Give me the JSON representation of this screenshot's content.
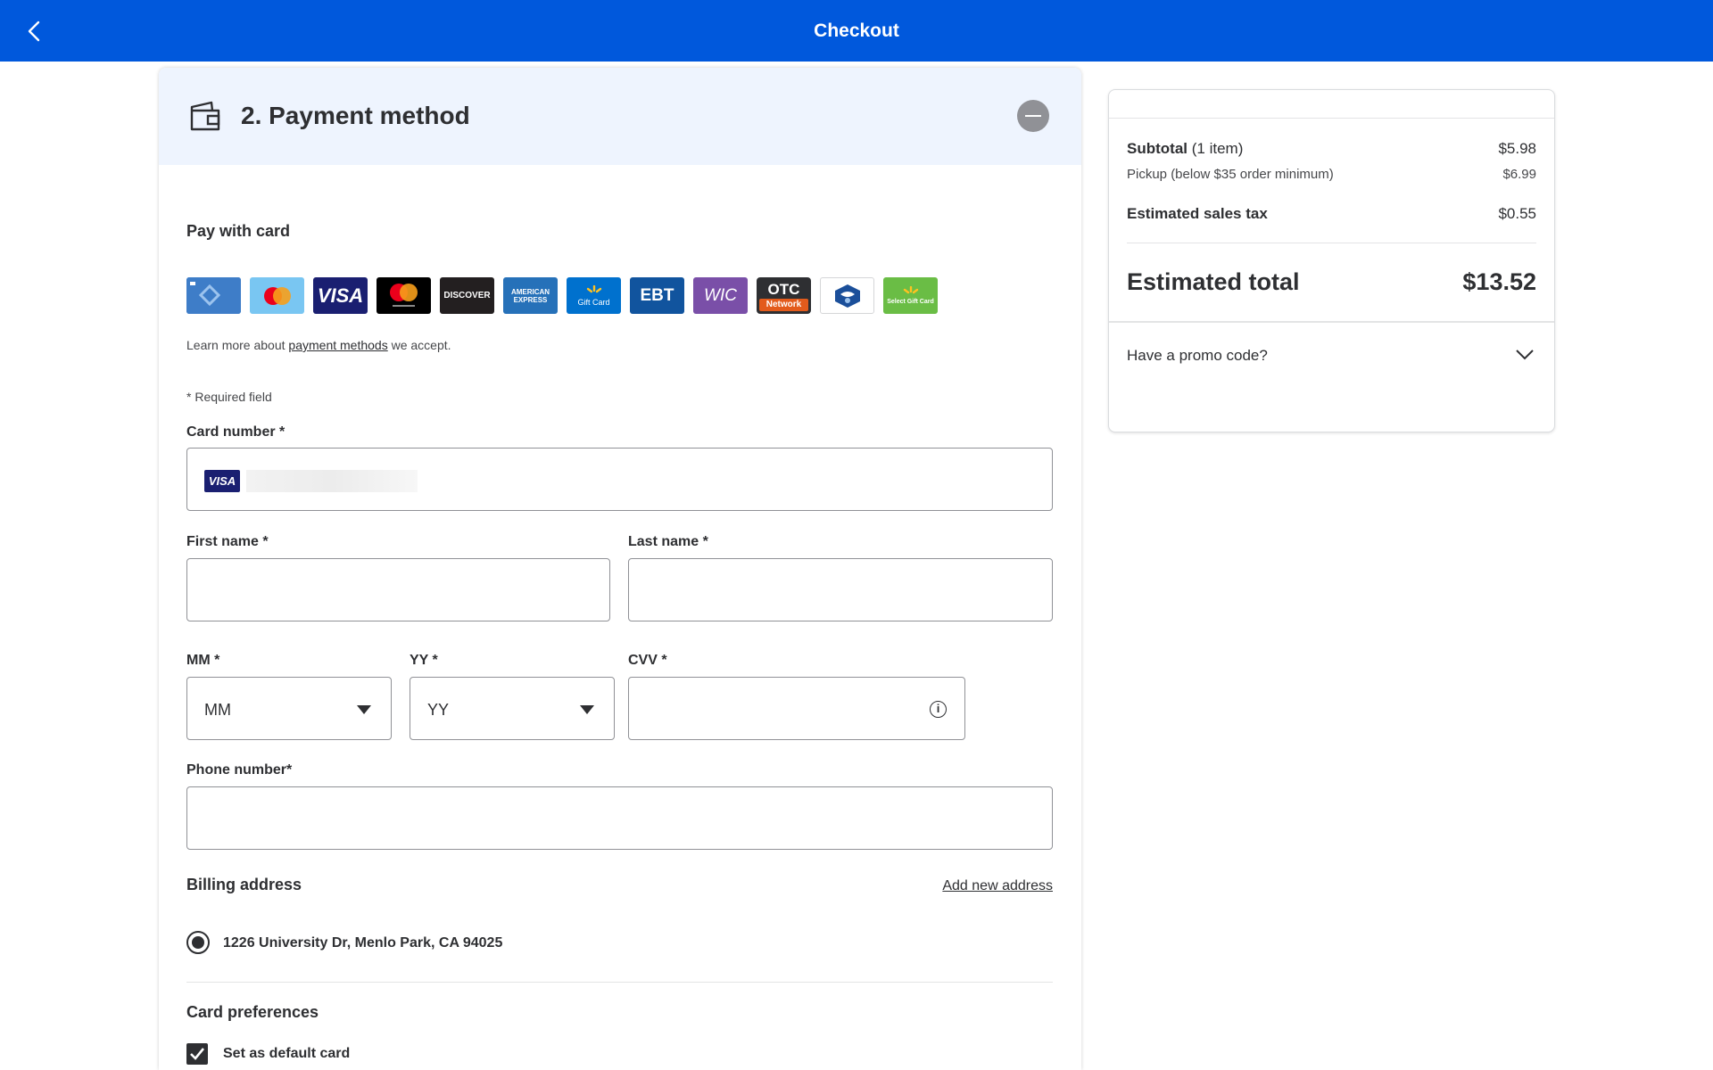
{
  "header": {
    "title": "Checkout",
    "back_icon": "chevron-left-icon"
  },
  "colors": {
    "brand_blue": "#0058dc",
    "panel_tint": "#eef4fe",
    "text": "#2e2f32"
  },
  "payment": {
    "section_title": "2. Payment method",
    "pay_with_card": "Pay with card",
    "accepted_cards": [
      {
        "name": "walmart-credit-card",
        "text": ""
      },
      {
        "name": "walmart-mastercard",
        "text": ""
      },
      {
        "name": "visa",
        "text": "VISA"
      },
      {
        "name": "mastercard",
        "text": "mastercard"
      },
      {
        "name": "discover",
        "text": "DISCOVER"
      },
      {
        "name": "american-express",
        "text": "AMERICAN EXPRESS"
      },
      {
        "name": "walmart-gift-card",
        "text": "Gift Card"
      },
      {
        "name": "ebt",
        "text": "EBT"
      },
      {
        "name": "wic",
        "text": "WIC"
      },
      {
        "name": "otc-network",
        "text": "OTC"
      },
      {
        "name": "benefits-card",
        "text": ""
      },
      {
        "name": "select-gift-card",
        "text": "Select Gift Card"
      }
    ],
    "otc_sub": "Network",
    "learn_pre": "Learn more about",
    "learn_link": "payment methods",
    "learn_post": "we accept.",
    "required_note": "* Required field",
    "card_number_label": "Card number *",
    "card_brand": "VISA",
    "first_name_label": "First name *",
    "last_name_label": "Last name *",
    "mm_label": "MM *",
    "mm_value": "MM",
    "yy_label": "YY *",
    "yy_value": "YY",
    "cvv_label": "CVV *",
    "phone_label": "Phone number*",
    "billing_title": "Billing address",
    "add_new_address": "Add new address",
    "address": "1226 University Dr, Menlo Park, CA 94025",
    "card_prefs_title": "Card preferences",
    "default_card_label": "Set as default card",
    "default_card_checked": true
  },
  "summary": {
    "subtotal_label": "Subtotal",
    "subtotal_count": "(1 item)",
    "subtotal_value": "$5.98",
    "pickup_label": "Pickup (below $35 order minimum)",
    "pickup_value": "$6.99",
    "tax_label": "Estimated sales tax",
    "tax_value": "$0.55",
    "total_label": "Estimated total",
    "total_value": "$13.52",
    "promo_label": "Have a promo code?"
  }
}
